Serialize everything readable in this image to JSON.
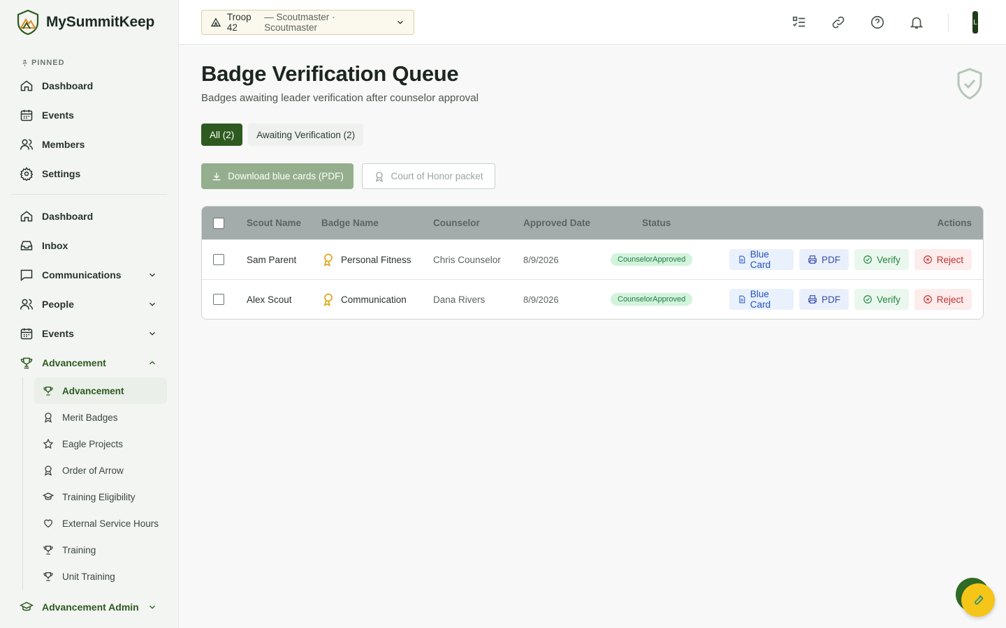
{
  "brand": {
    "name": "MySummitKeep"
  },
  "sidebar": {
    "pinned_label": "PINNED",
    "pinned": [
      {
        "label": "Dashboard",
        "icon": "home-icon"
      },
      {
        "label": "Events",
        "icon": "calendar-icon"
      },
      {
        "label": "Members",
        "icon": "users-icon"
      },
      {
        "label": "Settings",
        "icon": "gear-icon"
      }
    ],
    "nav": [
      {
        "label": "Dashboard",
        "icon": "home-icon"
      },
      {
        "label": "Inbox",
        "icon": "inbox-icon"
      },
      {
        "label": "Communications",
        "icon": "chat-icon"
      },
      {
        "label": "People",
        "icon": "users-icon"
      },
      {
        "label": "Events",
        "icon": "calendar-icon"
      },
      {
        "label": "Advancement",
        "icon": "trophy-icon"
      }
    ],
    "advancement_sub": [
      {
        "label": "Advancement",
        "icon": "trophy-icon"
      },
      {
        "label": "Merit Badges",
        "icon": "award-icon"
      },
      {
        "label": "Eagle Projects",
        "icon": "star-icon"
      },
      {
        "label": "Order of Arrow",
        "icon": "award-icon"
      },
      {
        "label": "Training Eligibility",
        "icon": "graduation-cap-icon"
      },
      {
        "label": "External Service Hours",
        "icon": "heart-icon"
      },
      {
        "label": "Training",
        "icon": "trophy-icon"
      },
      {
        "label": "Unit Training",
        "icon": "trophy-icon"
      }
    ],
    "admin": {
      "label": "Advancement Admin",
      "icon": "graduation-cap-icon"
    }
  },
  "topbar": {
    "troop": "Troop 42",
    "role": " — Scoutmaster · Scoutmaster",
    "avatar_initial": "L"
  },
  "page": {
    "title": "Badge Verification Queue",
    "subtitle": "Badges awaiting leader verification after counselor approval"
  },
  "tabs": [
    {
      "label": "All (2)"
    },
    {
      "label": "Awaiting Verification (2)"
    }
  ],
  "actions": {
    "download": "Download blue cards (PDF)",
    "court_of_honor": "Court of Honor packet"
  },
  "table": {
    "headers": {
      "scout": "Scout Name",
      "badge": "Badge Name",
      "counselor": "Counselor",
      "date": "Approved Date",
      "status": "Status",
      "actions": "Actions"
    },
    "rows": [
      {
        "scout": "Sam Parent",
        "badge": "Personal Fitness",
        "counselor": "Chris Counselor",
        "date": "8/9/2026",
        "status": "CounselorApproved"
      },
      {
        "scout": "Alex Scout",
        "badge": "Communication",
        "counselor": "Dana Rivers",
        "date": "8/9/2026",
        "status": "CounselorApproved"
      }
    ],
    "row_actions": {
      "blue_card": "Blue Card",
      "pdf": "PDF",
      "verify": "Verify",
      "reject": "Reject"
    }
  },
  "colors": {
    "primary": "#2d5a1e",
    "status_bg": "#d2f3dc",
    "badge_gold": "#e0a514"
  }
}
